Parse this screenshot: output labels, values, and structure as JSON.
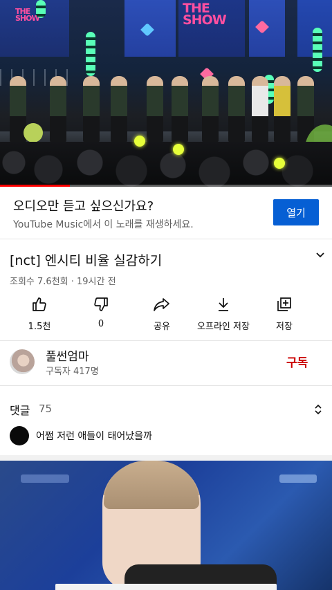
{
  "player": {
    "stage_logo_text": "THE SHOW",
    "progress_fraction": 0.21
  },
  "promo": {
    "title": "오디오만 듣고 싶으신가요?",
    "subtitle": "YouTube Music에서 이 노래를 재생하세요.",
    "button_label": "열기",
    "button_color": "#065fd4"
  },
  "video": {
    "title": "[nct] 엔시티 비율 실감하기",
    "meta": "조회수 7.6천회 · 19시간 전",
    "expand_icon": "chevron-down-icon"
  },
  "actions": [
    {
      "icon": "thumbs-up-icon",
      "label": "1.5천"
    },
    {
      "icon": "thumbs-down-icon",
      "label": "0"
    },
    {
      "icon": "share-icon",
      "label": "공유"
    },
    {
      "icon": "download-icon",
      "label": "오프라인 저장"
    },
    {
      "icon": "playlist-add-icon",
      "label": "저장"
    }
  ],
  "channel": {
    "name": "풀썬엄마",
    "subscribers": "구독자 417명",
    "subscribe_label": "구독",
    "subscribe_color": "#cc0000"
  },
  "comments": {
    "header": "댓글",
    "count": "75",
    "sort_icon": "unfold-icon",
    "top_comment": "어쩜 저런 애들이 태어났을까"
  }
}
